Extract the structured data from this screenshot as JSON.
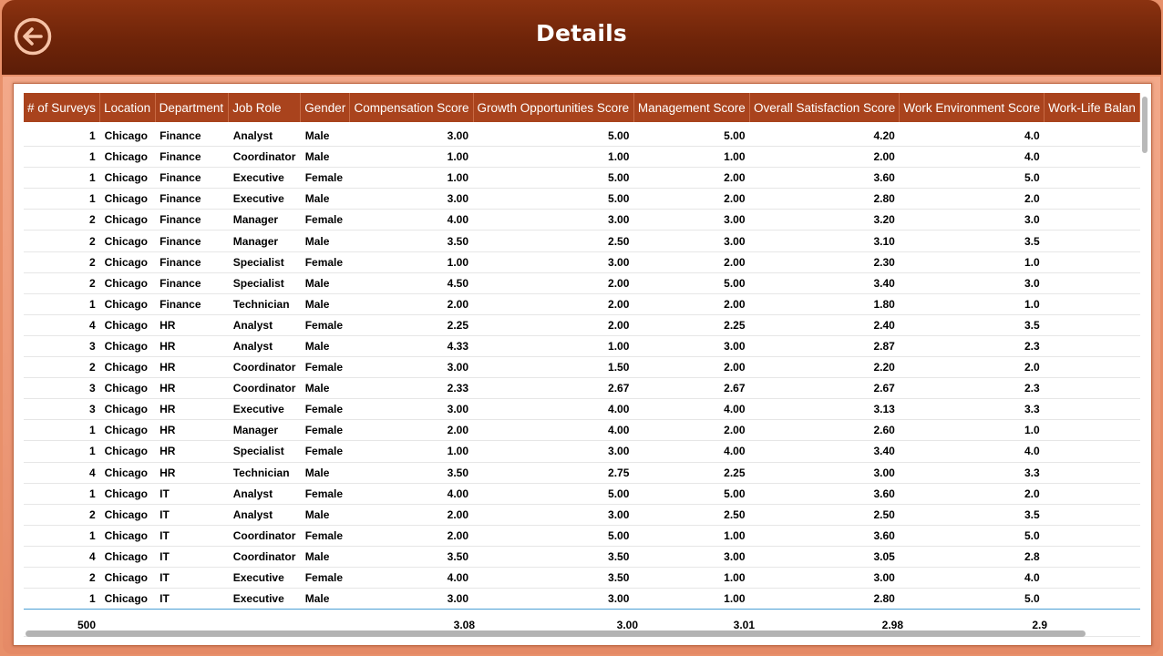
{
  "header": {
    "title": "Details",
    "back_icon": "back-arrow-circle-icon"
  },
  "colors": {
    "header": "#6e2409",
    "table_header": "#a9431d",
    "frame": "#ec9877",
    "total_divider": "#4a9fd5"
  },
  "table": {
    "columns": [
      "# of Surveys",
      "Location",
      "Department",
      "Job Role",
      "Gender",
      "Compensation Score",
      "Growth Opportunities Score",
      "Management Score",
      "Overall Satisfaction Score",
      "Work Environment Score",
      "Work-Life Balan"
    ],
    "rows": [
      [
        "1",
        "Chicago",
        "Finance",
        "Analyst",
        "Male",
        "3.00",
        "5.00",
        "5.00",
        "4.20",
        "4.0"
      ],
      [
        "1",
        "Chicago",
        "Finance",
        "Coordinator",
        "Male",
        "1.00",
        "1.00",
        "1.00",
        "2.00",
        "4.0"
      ],
      [
        "1",
        "Chicago",
        "Finance",
        "Executive",
        "Female",
        "1.00",
        "5.00",
        "2.00",
        "3.60",
        "5.0"
      ],
      [
        "1",
        "Chicago",
        "Finance",
        "Executive",
        "Male",
        "3.00",
        "5.00",
        "2.00",
        "2.80",
        "2.0"
      ],
      [
        "2",
        "Chicago",
        "Finance",
        "Manager",
        "Female",
        "4.00",
        "3.00",
        "3.00",
        "3.20",
        "3.0"
      ],
      [
        "2",
        "Chicago",
        "Finance",
        "Manager",
        "Male",
        "3.50",
        "2.50",
        "3.00",
        "3.10",
        "3.5"
      ],
      [
        "2",
        "Chicago",
        "Finance",
        "Specialist",
        "Female",
        "1.00",
        "3.00",
        "2.00",
        "2.30",
        "1.0"
      ],
      [
        "2",
        "Chicago",
        "Finance",
        "Specialist",
        "Male",
        "4.50",
        "2.00",
        "5.00",
        "3.40",
        "3.0"
      ],
      [
        "1",
        "Chicago",
        "Finance",
        "Technician",
        "Male",
        "2.00",
        "2.00",
        "2.00",
        "1.80",
        "1.0"
      ],
      [
        "4",
        "Chicago",
        "HR",
        "Analyst",
        "Female",
        "2.25",
        "2.00",
        "2.25",
        "2.40",
        "3.5"
      ],
      [
        "3",
        "Chicago",
        "HR",
        "Analyst",
        "Male",
        "4.33",
        "1.00",
        "3.00",
        "2.87",
        "2.3"
      ],
      [
        "2",
        "Chicago",
        "HR",
        "Coordinator",
        "Female",
        "3.00",
        "1.50",
        "2.00",
        "2.20",
        "2.0"
      ],
      [
        "3",
        "Chicago",
        "HR",
        "Coordinator",
        "Male",
        "2.33",
        "2.67",
        "2.67",
        "2.67",
        "2.3"
      ],
      [
        "3",
        "Chicago",
        "HR",
        "Executive",
        "Female",
        "3.00",
        "4.00",
        "4.00",
        "3.13",
        "3.3"
      ],
      [
        "1",
        "Chicago",
        "HR",
        "Manager",
        "Female",
        "2.00",
        "4.00",
        "2.00",
        "2.60",
        "1.0"
      ],
      [
        "1",
        "Chicago",
        "HR",
        "Specialist",
        "Female",
        "1.00",
        "3.00",
        "4.00",
        "3.40",
        "4.0"
      ],
      [
        "4",
        "Chicago",
        "HR",
        "Technician",
        "Male",
        "3.50",
        "2.75",
        "2.25",
        "3.00",
        "3.3"
      ],
      [
        "1",
        "Chicago",
        "IT",
        "Analyst",
        "Female",
        "4.00",
        "5.00",
        "5.00",
        "3.60",
        "2.0"
      ],
      [
        "2",
        "Chicago",
        "IT",
        "Analyst",
        "Male",
        "2.00",
        "3.00",
        "2.50",
        "2.50",
        "3.5"
      ],
      [
        "1",
        "Chicago",
        "IT",
        "Coordinator",
        "Female",
        "2.00",
        "5.00",
        "1.00",
        "3.60",
        "5.0"
      ],
      [
        "4",
        "Chicago",
        "IT",
        "Coordinator",
        "Male",
        "3.50",
        "3.50",
        "3.00",
        "3.05",
        "2.8"
      ],
      [
        "2",
        "Chicago",
        "IT",
        "Executive",
        "Female",
        "4.00",
        "3.50",
        "1.00",
        "3.00",
        "4.0"
      ],
      [
        "1",
        "Chicago",
        "IT",
        "Executive",
        "Male",
        "3.00",
        "3.00",
        "1.00",
        "2.80",
        "5.0"
      ]
    ],
    "totals": [
      "500",
      "",
      "",
      "",
      "",
      "3.08",
      "3.00",
      "3.01",
      "2.98",
      "2.9",
      ""
    ]
  }
}
